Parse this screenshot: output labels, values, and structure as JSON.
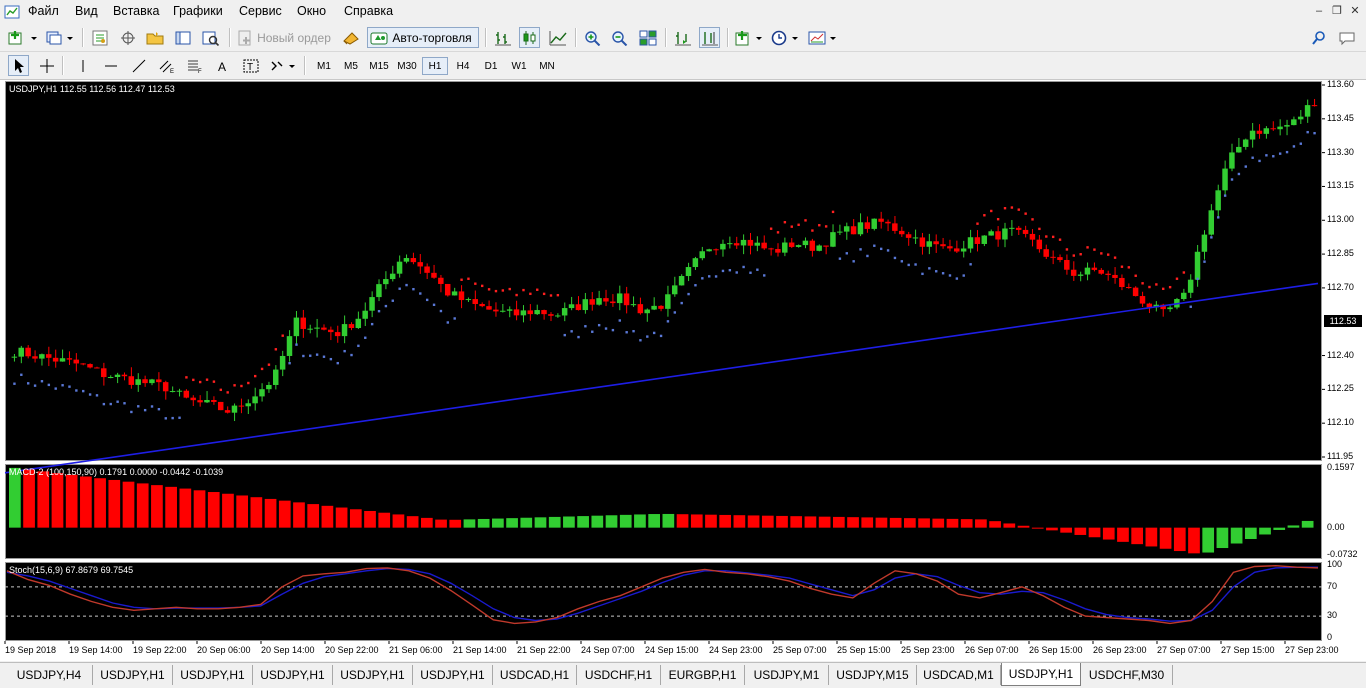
{
  "menu": {
    "items": [
      "Файл",
      "Вид",
      "Вставка",
      "Графики",
      "Сервис",
      "Окно",
      "Справка"
    ]
  },
  "toolbar": {
    "new_order_label": "Новый ордер",
    "autotrade_label": "Авто-торговля"
  },
  "timeframes": [
    "M1",
    "M5",
    "M15",
    "M30",
    "H1",
    "H4",
    "D1",
    "W1",
    "MN"
  ],
  "active_timeframe": "H1",
  "chart": {
    "main_header": "USDJPY,H1  112.55 112.56 112.47 112.53",
    "macd_header": "MACD-2 (100,150,90) 0.1791 0.0000 -0.0442 -0.1039",
    "stoch_header": "Stoch(15,6,9) 67.8679 69.7545",
    "current_price": "112.53",
    "price_ticks": [
      "113.60",
      "113.45",
      "113.30",
      "113.15",
      "113.00",
      "112.85",
      "112.70",
      "112.40",
      "112.25",
      "112.10",
      "111.95"
    ],
    "macd_ticks": [
      "0.1597",
      "0.00",
      "-0.0732"
    ],
    "stoch_ticks": [
      "100",
      "70",
      "30",
      "0"
    ],
    "time_ticks": [
      "19 Sep 2018",
      "19 Sep 14:00",
      "19 Sep 22:00",
      "20 Sep 06:00",
      "20 Sep 14:00",
      "20 Sep 22:00",
      "21 Sep 06:00",
      "21 Sep 14:00",
      "21 Sep 22:00",
      "24 Sep 07:00",
      "24 Sep 15:00",
      "24 Sep 23:00",
      "25 Sep 07:00",
      "25 Sep 15:00",
      "25 Sep 23:00",
      "26 Sep 07:00",
      "26 Sep 15:00",
      "26 Sep 23:00",
      "27 Sep 07:00",
      "27 Sep 15:00",
      "27 Sep 23:00"
    ],
    "colors": {
      "background": "#000000",
      "bull": "#32cd32",
      "bear": "#ff0000",
      "ma_line": "#1e1ee6",
      "trend_dots_up": "#5a78d6",
      "trend_dots_down": "#ff2020",
      "stoch_main": "#c0392b",
      "stoch_signal": "#1a1acd"
    }
  },
  "chart_data": {
    "type": "candlestick",
    "symbol": "USDJPY",
    "timeframe": "H1",
    "ylim": [
      111.95,
      113.6
    ],
    "close_path": [
      112.42,
      112.4,
      112.38,
      112.36,
      112.32,
      112.3,
      112.28,
      112.26,
      112.2,
      112.18,
      112.15,
      112.22,
      112.3,
      112.55,
      112.52,
      112.5,
      112.58,
      112.72,
      112.85,
      112.78,
      112.68,
      112.63,
      112.6,
      112.58,
      112.6,
      112.58,
      112.62,
      112.66,
      112.65,
      112.6,
      112.63,
      112.76,
      112.88,
      112.92,
      112.9,
      112.86,
      112.9,
      112.88,
      112.94,
      112.97,
      112.99,
      112.95,
      112.9,
      112.87,
      112.9,
      112.93,
      112.95,
      112.9,
      112.82,
      112.76,
      112.78,
      112.72,
      112.65,
      112.58,
      112.66,
      112.98,
      113.25,
      113.4,
      113.4,
      113.43,
      113.53
    ],
    "ma_start": 111.88,
    "ma_end": 112.72,
    "macd_range": [
      -0.0732,
      0.1597
    ],
    "stoch_levels": [
      70,
      30
    ]
  },
  "tabs": [
    "USDJPY,H4",
    "USDJPY,H1",
    "USDJPY,H1",
    "USDJPY,H1",
    "USDJPY,H1",
    "USDJPY,H1",
    "USDCAD,H1",
    "USDCHF,H1",
    "EURGBP,H1",
    "USDJPY,M1",
    "USDJPY,M15",
    "USDCAD,M1",
    "USDJPY,H1",
    "USDCHF,M30"
  ],
  "active_tab_index": 12
}
